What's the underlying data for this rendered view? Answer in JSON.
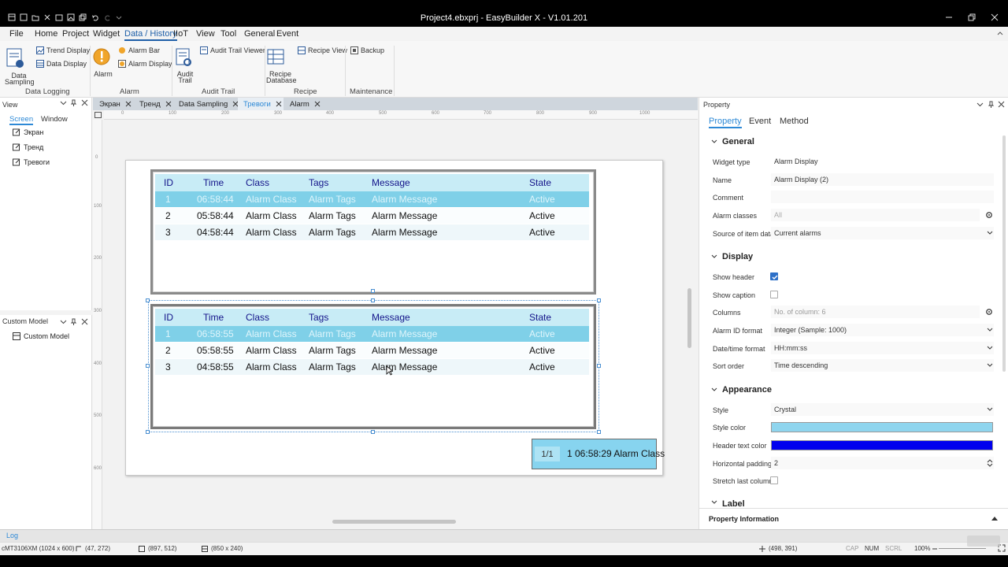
{
  "app": {
    "title": "Project4.ebxprj - EasyBuilder X - V1.01.201"
  },
  "menu": [
    "File",
    "Home",
    "Project",
    "Widget",
    "Data / History",
    "IIoT",
    "View",
    "Tool",
    "General",
    "Event"
  ],
  "ribbon": {
    "data_sampling": "Data Sampling",
    "trend_display": "Trend Display",
    "data_display": "Data Display",
    "alarm": "Alarm",
    "alarm_bar": "Alarm Bar",
    "alarm_display": "Alarm Display",
    "audit_trail": "Audit Trail",
    "audit_trail_viewer": "Audit Trail Viewer",
    "recipe_database": "Recipe Database",
    "recipe_view": "Recipe View",
    "backup": "Backup",
    "groups": [
      "Data Logging",
      "Alarm",
      "Audit Trail",
      "Recipe",
      "Maintenance"
    ]
  },
  "view_panel": {
    "title": "View",
    "tabs": [
      "Screen",
      "Window"
    ],
    "items": [
      "Экран",
      "Тренд",
      "Тревоги"
    ]
  },
  "custom_panel": {
    "title": "Custom Model",
    "items": [
      "Custom Model"
    ]
  },
  "doc_tabs": [
    "Экран",
    "Тренд",
    "Data Sampling",
    "Тревоги",
    "Alarm"
  ],
  "ruler": {
    "top": [
      "0",
      "100",
      "200",
      "300",
      "400",
      "500",
      "600",
      "700",
      "800",
      "900",
      "1000"
    ],
    "left": [
      "0",
      "100",
      "200",
      "300",
      "400",
      "500",
      "600"
    ]
  },
  "alarm_table": {
    "headers": [
      "ID",
      "Time",
      "Class",
      "Tags",
      "Message",
      "State"
    ],
    "table1": [
      [
        "1",
        "06:58:44",
        "Alarm Class",
        "Alarm Tags",
        "Alarm Message",
        "Active"
      ],
      [
        "2",
        "05:58:44",
        "Alarm Class",
        "Alarm Tags",
        "Alarm Message",
        "Active"
      ],
      [
        "3",
        "04:58:44",
        "Alarm Class",
        "Alarm Tags",
        "Alarm Message",
        "Active"
      ]
    ],
    "table2": [
      [
        "1",
        "06:58:55",
        "Alarm Class",
        "Alarm Tags",
        "Alarm Message",
        "Active"
      ],
      [
        "2",
        "05:58:55",
        "Alarm Class",
        "Alarm Tags",
        "Alarm Message",
        "Active"
      ],
      [
        "3",
        "04:58:55",
        "Alarm Class",
        "Alarm Tags",
        "Alarm Message",
        "Active"
      ]
    ]
  },
  "alarm_bar": {
    "page": "1/1",
    "text": "1 06:58:29 Alarm Class"
  },
  "property": {
    "title": "Property",
    "tabs": [
      "Property",
      "Event",
      "Method"
    ],
    "general": "General",
    "widget_type_label": "Widget type",
    "widget_type": "Alarm Display",
    "name_label": "Name",
    "name": "Alarm Display (2)",
    "comment_label": "Comment",
    "comment": "",
    "alarm_classes_label": "Alarm classes",
    "alarm_classes": "All",
    "source_label": "Source of item data",
    "source": "Current alarms",
    "display": "Display",
    "show_header_label": "Show header",
    "show_header": true,
    "show_caption_label": "Show caption",
    "show_caption": false,
    "columns_label": "Columns",
    "columns": "No. of column: 6",
    "alarm_id_format_label": "Alarm ID format",
    "alarm_id_format": "Integer (Sample: 1000)",
    "datetime_format_label": "Date/time format",
    "datetime_format": "HH:mm:ss",
    "sort_order_label": "Sort order",
    "sort_order": "Time descending",
    "appearance": "Appearance",
    "style_label": "Style",
    "style": "Crystal",
    "style_color_label": "Style color",
    "style_color": "#8fd5ee",
    "header_text_color_label": "Header text color",
    "header_text_color": "#0000ee",
    "hpad_label": "Horizontal padding",
    "hpad": "2",
    "stretch_label": "Stretch last column",
    "stretch": false,
    "label_section": "Label",
    "info": "Property Information"
  },
  "log": "Log",
  "status": {
    "model": "cMT3106XM (1024 x 600)",
    "pos": "(47, 272)",
    "end": "(897, 512)",
    "size": "(850 x 240)",
    "cursor": "(498, 391)",
    "cap": "CAP",
    "num": "NUM",
    "scrl": "SCRL",
    "zoom": "100%"
  },
  "colors": {
    "accent": "#1e5fa8",
    "header_bg": "#c8ecf6",
    "selected_row": "#7fd0e8"
  }
}
